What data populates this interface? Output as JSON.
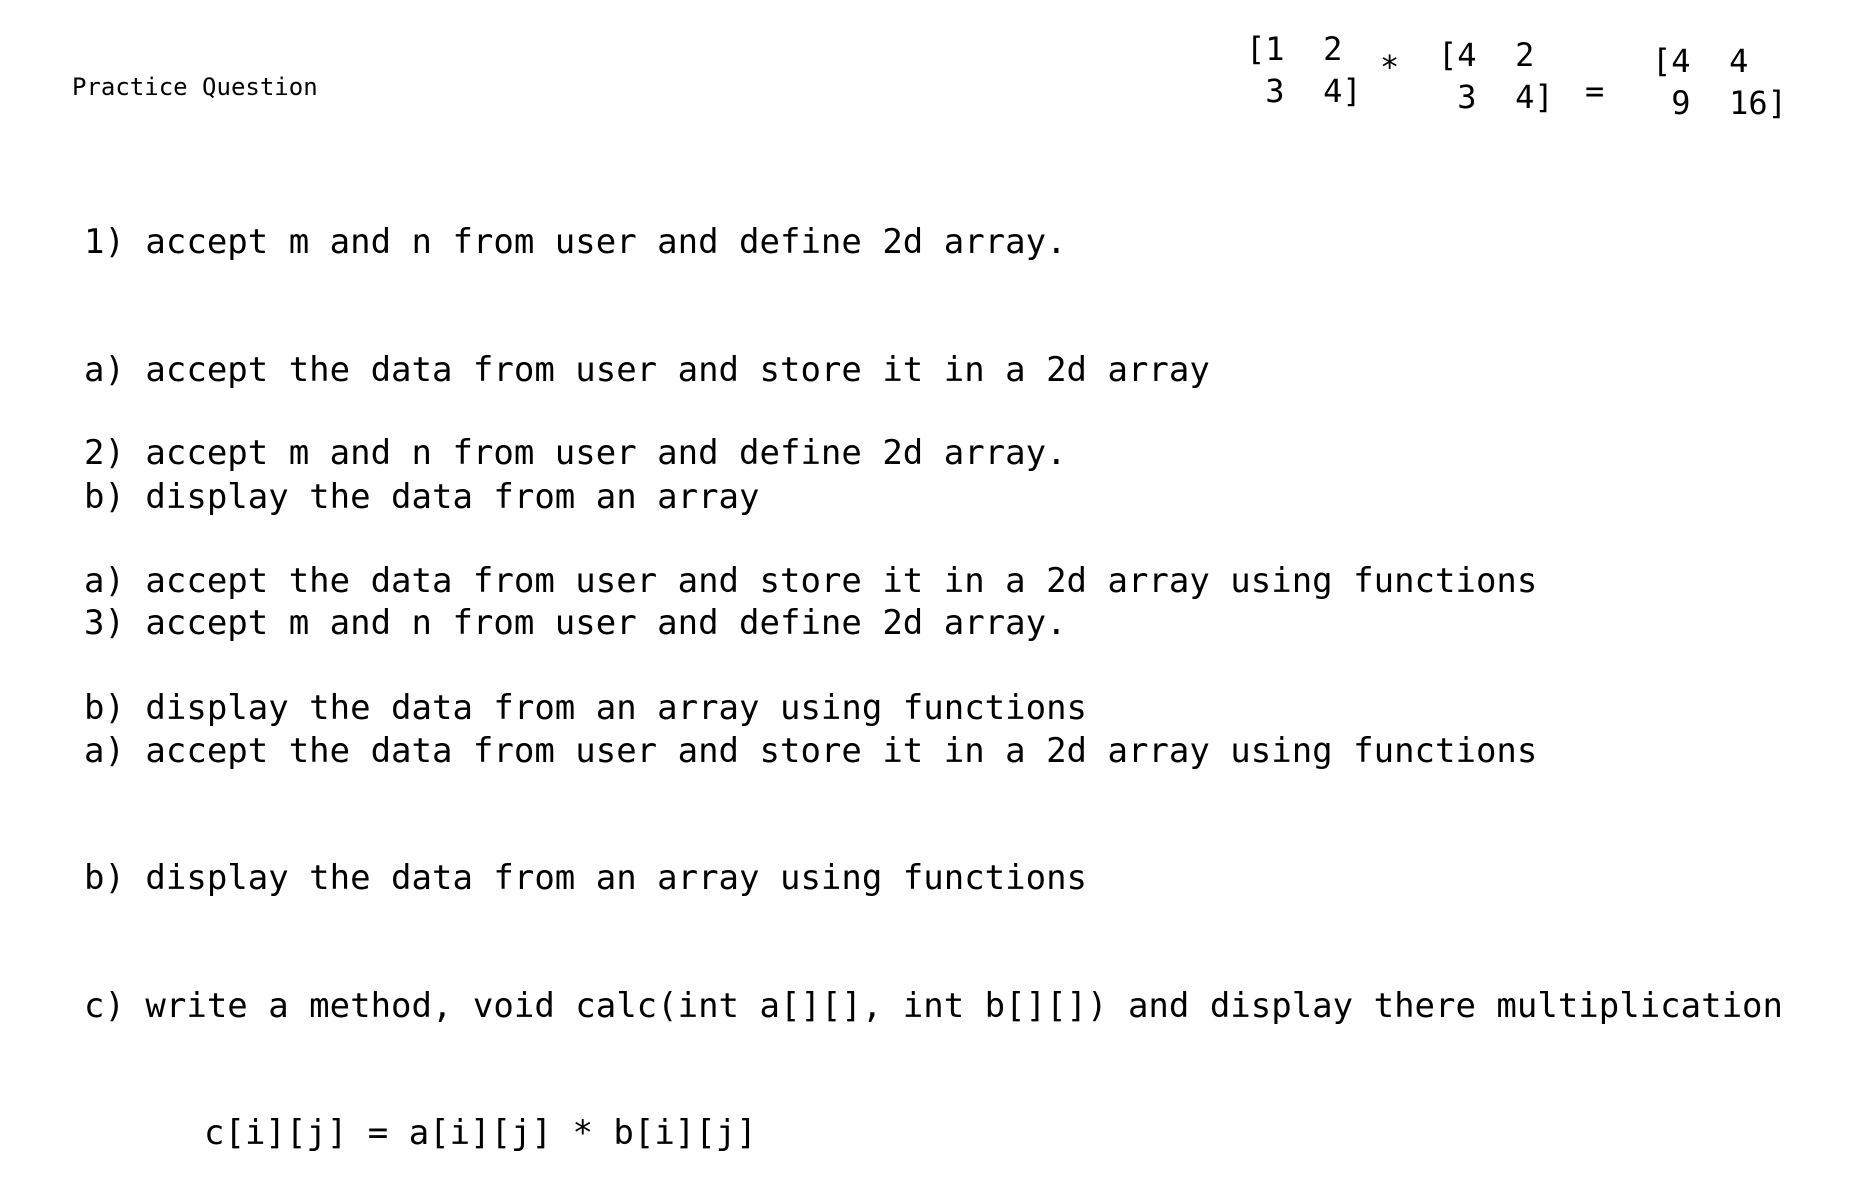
{
  "title": "Practice Question",
  "matrices": {
    "a": {
      "row1": "[1  2",
      "row2": " 3  4]"
    },
    "mul_op": "*",
    "b": {
      "row1": "[4  2",
      "row2": " 3  4]"
    },
    "eq_op": "=",
    "c": {
      "row1": "[4  4",
      "row2": " 9  16]"
    }
  },
  "questions": [
    {
      "lines": [
        "1) accept m and n from user and define 2d array.",
        "a) accept the data from user and store it in a 2d array",
        "b) display the data from an array"
      ]
    },
    {
      "lines": [
        "2) accept m and n from user and define 2d array.",
        "a) accept the data from user and store it in a 2d array using functions",
        "b) display the data from an array using functions"
      ]
    },
    {
      "lines": [
        "3) accept m and n from user and define 2d array.",
        "a) accept the data from user and store it in a 2d array using functions",
        "b) display the data from an array using functions",
        "c) write a method, void calc(int a[][], int b[][]) and display there multiplication"
      ],
      "formula": "c[i][j] = a[i][j] * b[i][j]"
    }
  ]
}
